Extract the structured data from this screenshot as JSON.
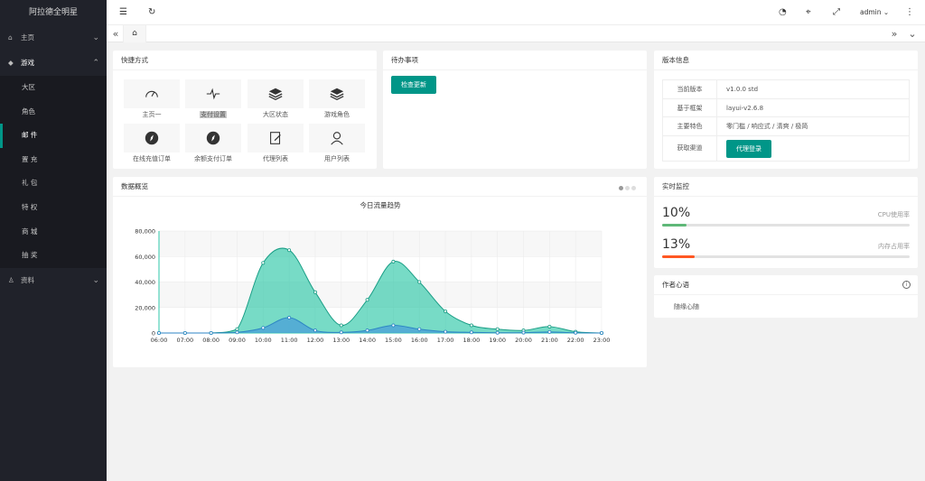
{
  "sidebar": {
    "logo": "阿拉德全明星",
    "menu": [
      {
        "label": "主页",
        "icon": "home-icon"
      },
      {
        "label": "游戏",
        "icon": "diamond-icon"
      },
      {
        "label": "资料",
        "icon": "user-icon"
      }
    ],
    "game_items": [
      {
        "label": "大区"
      },
      {
        "label": "角色"
      },
      {
        "label": "邮 件"
      },
      {
        "label": "置 充"
      },
      {
        "label": "礼 包"
      },
      {
        "label": "特 权"
      },
      {
        "label": "商 城"
      },
      {
        "label": "抽 奖"
      }
    ]
  },
  "header": {
    "user": "admin"
  },
  "quick": {
    "title": "快捷方式",
    "items": [
      {
        "label": "主页一",
        "icon": "gauge-icon"
      },
      {
        "label": "支付设置",
        "icon": "pulse-icon"
      },
      {
        "label": "大区状态",
        "icon": "layers-icon"
      },
      {
        "label": "游戏角色",
        "icon": "layers-icon"
      },
      {
        "label": "在线充值订单",
        "icon": "compass-icon"
      },
      {
        "label": "余额支付订单",
        "icon": "compass-icon"
      },
      {
        "label": "代理列表",
        "icon": "edit-icon"
      },
      {
        "label": "用户列表",
        "icon": "user-icon"
      }
    ]
  },
  "todo": {
    "title": "待办事项",
    "button": "检查更新"
  },
  "version": {
    "title": "版本信息",
    "rows": [
      {
        "key": "当前版本",
        "value": "v1.0.0 std"
      },
      {
        "key": "基于框架",
        "value": "layui-v2.6.8"
      },
      {
        "key": "主要特色",
        "value": "零门槛 / 响应式 / 清爽 / 极简"
      },
      {
        "key": "获取渠道",
        "value": ""
      }
    ],
    "agent_button": "代理登录"
  },
  "overview": {
    "title": "数据概览"
  },
  "monitor": {
    "title": "实时监控",
    "cpu": {
      "value": "10%",
      "label": "CPU使用率",
      "fraction": 0.1,
      "color": "#5FB878"
    },
    "mem": {
      "value": "13%",
      "label": "内存占用率",
      "fraction": 0.13,
      "color": "#FF5722"
    }
  },
  "author": {
    "title": "作者心语",
    "text": "随缘心随"
  },
  "chart_data": {
    "type": "area",
    "title": "今日流量趋势",
    "x": [
      "06:00",
      "07:00",
      "08:00",
      "09:00",
      "10:00",
      "11:00",
      "12:00",
      "13:00",
      "14:00",
      "15:00",
      "16:00",
      "17:00",
      "18:00",
      "19:00",
      "20:00",
      "21:00",
      "22:00",
      "23:00"
    ],
    "ylim": [
      0,
      80000
    ],
    "yticks": [
      0,
      20000,
      40000,
      60000,
      80000
    ],
    "ytick_labels": [
      "0",
      "20,000",
      "40,000",
      "60,000",
      "80,000"
    ],
    "grid": true,
    "series": [
      {
        "values": [
          0,
          0,
          0,
          3000,
          55000,
          65000,
          32000,
          6000,
          26000,
          56000,
          40000,
          17000,
          6000,
          3000,
          2000,
          5000,
          1000,
          0
        ],
        "color": "#2ec7a8"
      },
      {
        "values": [
          0,
          0,
          0,
          500,
          4000,
          12000,
          2000,
          500,
          2000,
          6000,
          3000,
          1000,
          500,
          200,
          300,
          800,
          200,
          0
        ],
        "color": "#4a9fd8"
      }
    ]
  }
}
